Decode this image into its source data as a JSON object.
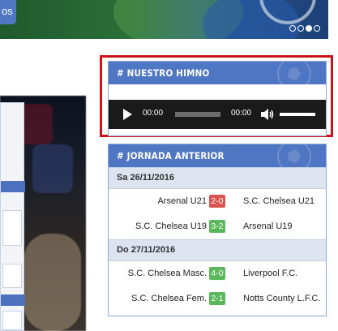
{
  "hero": {
    "button_label": "os",
    "slides": 4,
    "active_slide": 3
  },
  "widgets": {
    "himno": {
      "title": "# NUESTRO HIMNO",
      "player": {
        "current_time": "00:00",
        "duration": "00:00"
      }
    },
    "jornada": {
      "title": "# JORNADA ANTERIOR",
      "days": [
        {
          "date": "Sa 26/11/2016",
          "matches": [
            {
              "home": "Arsenal U21",
              "score": "2-0",
              "result": "loss",
              "away": "S.C. Chelsea U21"
            },
            {
              "home": "S.C. Chelsea U19",
              "score": "3-2",
              "result": "win",
              "away": "Arsenal U19"
            }
          ]
        },
        {
          "date": "Do 27/11/2016",
          "matches": [
            {
              "home": "S.C. Chelsea Masc.",
              "score": "4-0",
              "result": "win",
              "away": "Liverpool F.C."
            },
            {
              "home": "S.C. Chelsea Fem.",
              "score": "2-1",
              "result": "win",
              "away": "Notts County L.F.C."
            }
          ]
        }
      ]
    }
  },
  "colors": {
    "widget_header": "#4f76c2",
    "highlight_frame": "#d0121b",
    "score_loss": "#d9534f",
    "score_win": "#5cb85c"
  }
}
